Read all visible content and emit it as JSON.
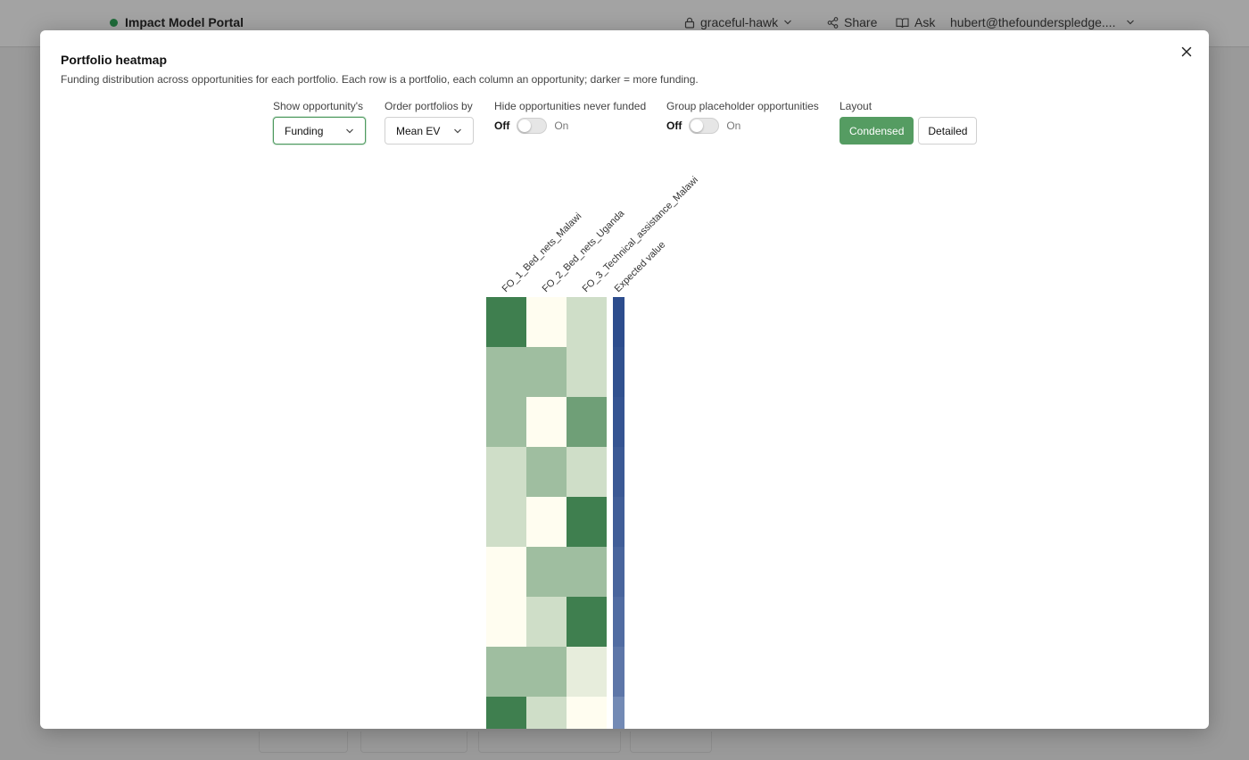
{
  "app": {
    "title": "Impact Model Portal",
    "workspace": "graceful-hawk",
    "share_label": "Share",
    "ask_label": "Ask",
    "user": "hubert@thefounderspledge...."
  },
  "modal": {
    "title": "Portfolio heatmap",
    "description": "Funding distribution across opportunities for each portfolio. Each row is a portfolio, each column an opportunity; darker = more funding."
  },
  "controls": {
    "show_label": "Show opportunity's",
    "show_value": "Funding",
    "order_label": "Order portfolios by",
    "order_value": "Mean EV",
    "hide_label": "Hide opportunities never funded",
    "group_label": "Group placeholder opportunities",
    "off_label": "Off",
    "on_label": "On",
    "hide_on": false,
    "group_on": false,
    "layout_label": "Layout",
    "layout_condensed": "Condensed",
    "layout_detailed": "Detailed",
    "layout_selected": "Condensed"
  },
  "chart_data": {
    "type": "heatmap",
    "columns": [
      "FO_1_Bed_nets_Malawi",
      "FO_2_Bed_nets_Uganda",
      "FO_3_Technical_assistance_Malawi"
    ],
    "ev_label": "Expected value",
    "funding_levels": [
      [
        4,
        0,
        1
      ],
      [
        2,
        2,
        1
      ],
      [
        2,
        0,
        3
      ],
      [
        1,
        2,
        1
      ],
      [
        1,
        0,
        4
      ],
      [
        0,
        2,
        2
      ],
      [
        0,
        1,
        4
      ],
      [
        2,
        2,
        0.5
      ],
      [
        4,
        1,
        0
      ]
    ],
    "expected_value_levels": [
      1.0,
      0.97,
      0.94,
      0.9,
      0.86,
      0.8,
      0.74,
      0.66,
      0.5
    ],
    "funding_colors": {
      "low": "#fffdf0",
      "high": "#3f7f4f"
    },
    "ev_colors": {
      "low": "#b9c6dd",
      "high": "#2d4d8d"
    }
  }
}
